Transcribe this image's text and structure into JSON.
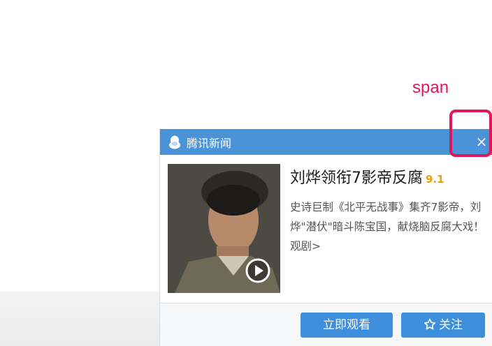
{
  "annotation": {
    "label": "span"
  },
  "popup": {
    "title": "腾讯新闻",
    "close_symbol": "×",
    "headline": "刘烨领衔7影帝反腐",
    "rating": "9.1",
    "description": "史诗巨制《北平无战事》集齐7影帝，刘烨\"潜伏\"暗斗陈宝国，献烧脑反腐大戏！观剧>",
    "buttons": {
      "watch": "立即观看",
      "follow": "关注"
    }
  },
  "icons": {
    "logo": "qq-penguin-icon",
    "close": "close-icon",
    "play": "play-icon",
    "follow": "star-icon"
  },
  "colors": {
    "header": "#4a93d9",
    "button": "#3d8edb",
    "rating": "#f0a000",
    "annotation": "#e0185b"
  }
}
